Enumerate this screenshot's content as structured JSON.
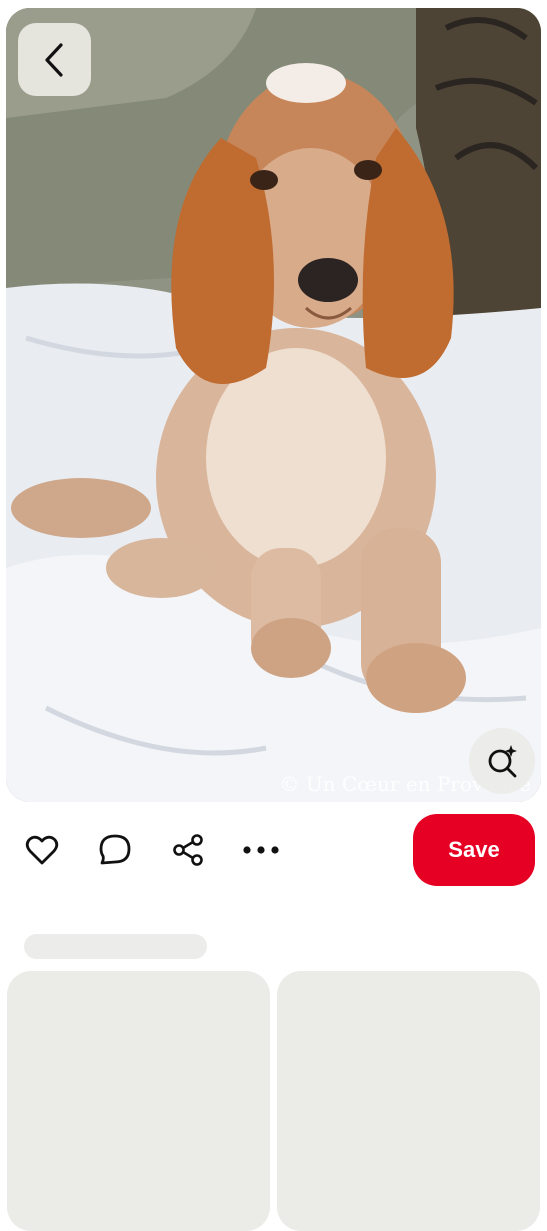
{
  "pin": {
    "image_alt": "Cocker spaniel puppy sitting on a white blanket",
    "watermark": "© Un Cœur en Provence"
  },
  "actions": {
    "like": "heart-icon",
    "comment": "comment-icon",
    "share": "share-icon",
    "more": "more-icon",
    "save_label": "Save"
  },
  "colors": {
    "save_button": "#e60023",
    "skeleton": "#ebebe8",
    "icon": "#111111"
  }
}
